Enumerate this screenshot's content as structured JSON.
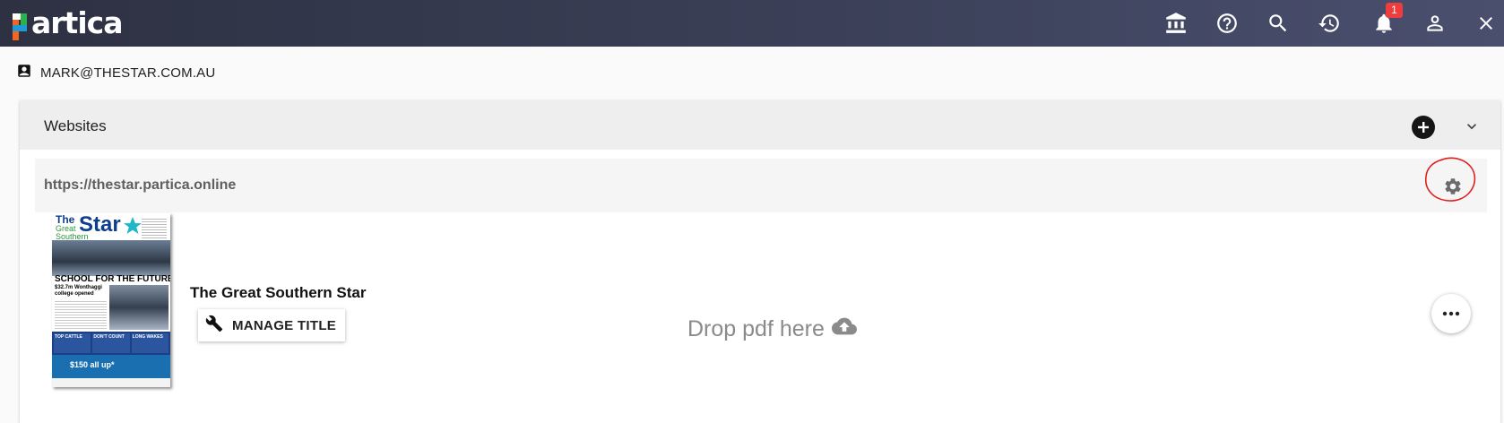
{
  "app": {
    "name": "partica",
    "logo_letter": "p",
    "logo_rest": "artica",
    "brand_colors": {
      "orange": "#f26522",
      "green": "#2bb24c",
      "blue": "#1e9ad6"
    }
  },
  "topbar": {
    "icons": [
      "bank-icon",
      "help-icon",
      "search-icon",
      "history-icon",
      "notifications-icon",
      "account-icon",
      "close-icon"
    ],
    "notification_count": "1",
    "badge_color": "#ef3d3d"
  },
  "user": {
    "email": "MARK@THESTAR.COM.AU",
    "icon": "contact-card-icon"
  },
  "websites": {
    "title": "Websites",
    "url": "https://thestar.partica.online",
    "publication": {
      "name": "The Great Southern Star",
      "manage_label": "MANAGE TITLE",
      "drop_label": "Drop pdf here",
      "cover": {
        "masthead_line1": "The",
        "masthead_line2": "Great",
        "masthead_line3": "Southern",
        "masthead_star": "Star",
        "headline": "SCHOOL FOR THE FUTURE",
        "subhead": "$32.7m Wonthaggi college opened",
        "promo1": "TOP CATTLE",
        "promo2": "DON'T COUNT",
        "promo3": "LONG WAKES",
        "ad_text": "$150 all up*"
      }
    }
  },
  "annotation_color": "#e0201d"
}
